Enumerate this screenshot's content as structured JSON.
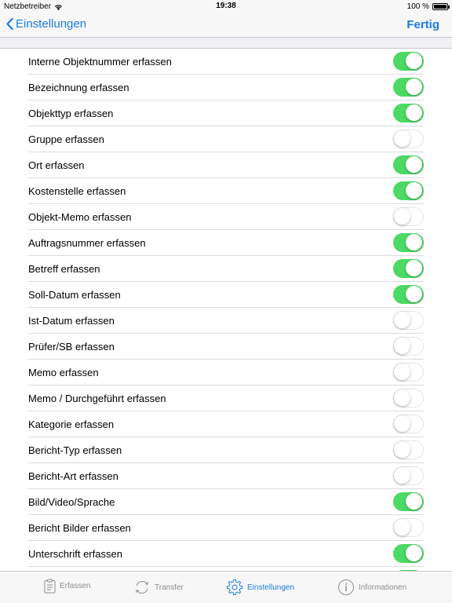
{
  "status": {
    "carrier": "Netzbetreiber",
    "time": "19:38",
    "battery": "100 %",
    "battery_level": 1.0
  },
  "nav": {
    "back_label": "Einstellungen",
    "done_label": "Fertig"
  },
  "colors": {
    "accent": "#1a7ce6",
    "toggle_on": "#4cd964"
  },
  "settings": [
    {
      "label": "Interne Objektnummer erfassen",
      "on": true
    },
    {
      "label": "Bezeichnung erfassen",
      "on": true
    },
    {
      "label": "Objekttyp erfassen",
      "on": true
    },
    {
      "label": "Gruppe erfassen",
      "on": false
    },
    {
      "label": "Ort erfassen",
      "on": true
    },
    {
      "label": "Kostenstelle erfassen",
      "on": true
    },
    {
      "label": "Objekt-Memo erfassen",
      "on": false
    },
    {
      "label": "Auftragsnummer erfassen",
      "on": true
    },
    {
      "label": "Betreff erfassen",
      "on": true
    },
    {
      "label": "Soll-Datum erfassen",
      "on": true
    },
    {
      "label": "Ist-Datum erfassen",
      "on": false
    },
    {
      "label": "Prüfer/SB erfassen",
      "on": false
    },
    {
      "label": "Memo erfassen",
      "on": false
    },
    {
      "label": "Memo / Durchgeführt erfassen",
      "on": false
    },
    {
      "label": "Kategorie erfassen",
      "on": false
    },
    {
      "label": "Bericht-Typ erfassen",
      "on": false
    },
    {
      "label": "Bericht-Art erfassen",
      "on": false
    },
    {
      "label": "Bild/Video/Sprache",
      "on": true
    },
    {
      "label": "Bericht Bilder erfassen",
      "on": false
    },
    {
      "label": "Unterschrift erfassen",
      "on": true
    },
    {
      "label": "",
      "on": true
    }
  ],
  "tabs": [
    {
      "label": "Erfassen",
      "icon": "clipboard-icon",
      "active": false
    },
    {
      "label": "Transfer",
      "icon": "sync-icon",
      "active": false
    },
    {
      "label": "Einstellungen",
      "icon": "gear-icon",
      "active": true
    },
    {
      "label": "Informationen",
      "icon": "info-icon",
      "active": false
    }
  ]
}
